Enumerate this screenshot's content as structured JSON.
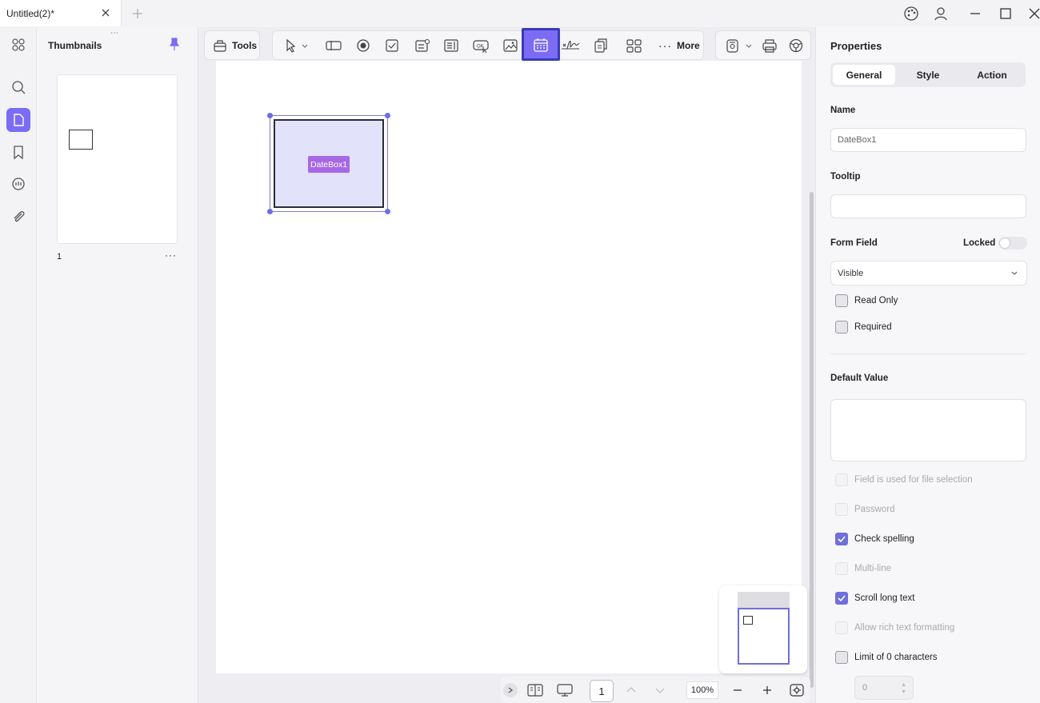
{
  "tab": {
    "title": "Untitled(2)*"
  },
  "thumbnails": {
    "title": "Thumbnails",
    "page_number": "1"
  },
  "toolbar": {
    "tools_label": "Tools",
    "more_label": "More"
  },
  "form_field": {
    "label": "DateBox1"
  },
  "bottombar": {
    "page": "1",
    "zoom": "100%"
  },
  "properties": {
    "title": "Properties",
    "tabs": [
      "General",
      "Style",
      "Action"
    ],
    "name_label": "Name",
    "name_value": "DateBox1",
    "tooltip_label": "Tooltip",
    "tooltip_value": "",
    "form_field_label": "Form Field",
    "locked_label": "Locked",
    "visibility": "Visible",
    "read_only": "Read Only",
    "required": "Required",
    "default_value_label": "Default Value",
    "options": [
      "Field is used for file selection",
      "Password",
      "Check spelling",
      "Multi-line",
      "Scroll long text",
      "Allow rich text formatting",
      "Limit of 0 characters"
    ],
    "limit_value": "0"
  },
  "colors": {
    "accent": "#7b6cf6",
    "active_border": "#3b3bb8"
  }
}
